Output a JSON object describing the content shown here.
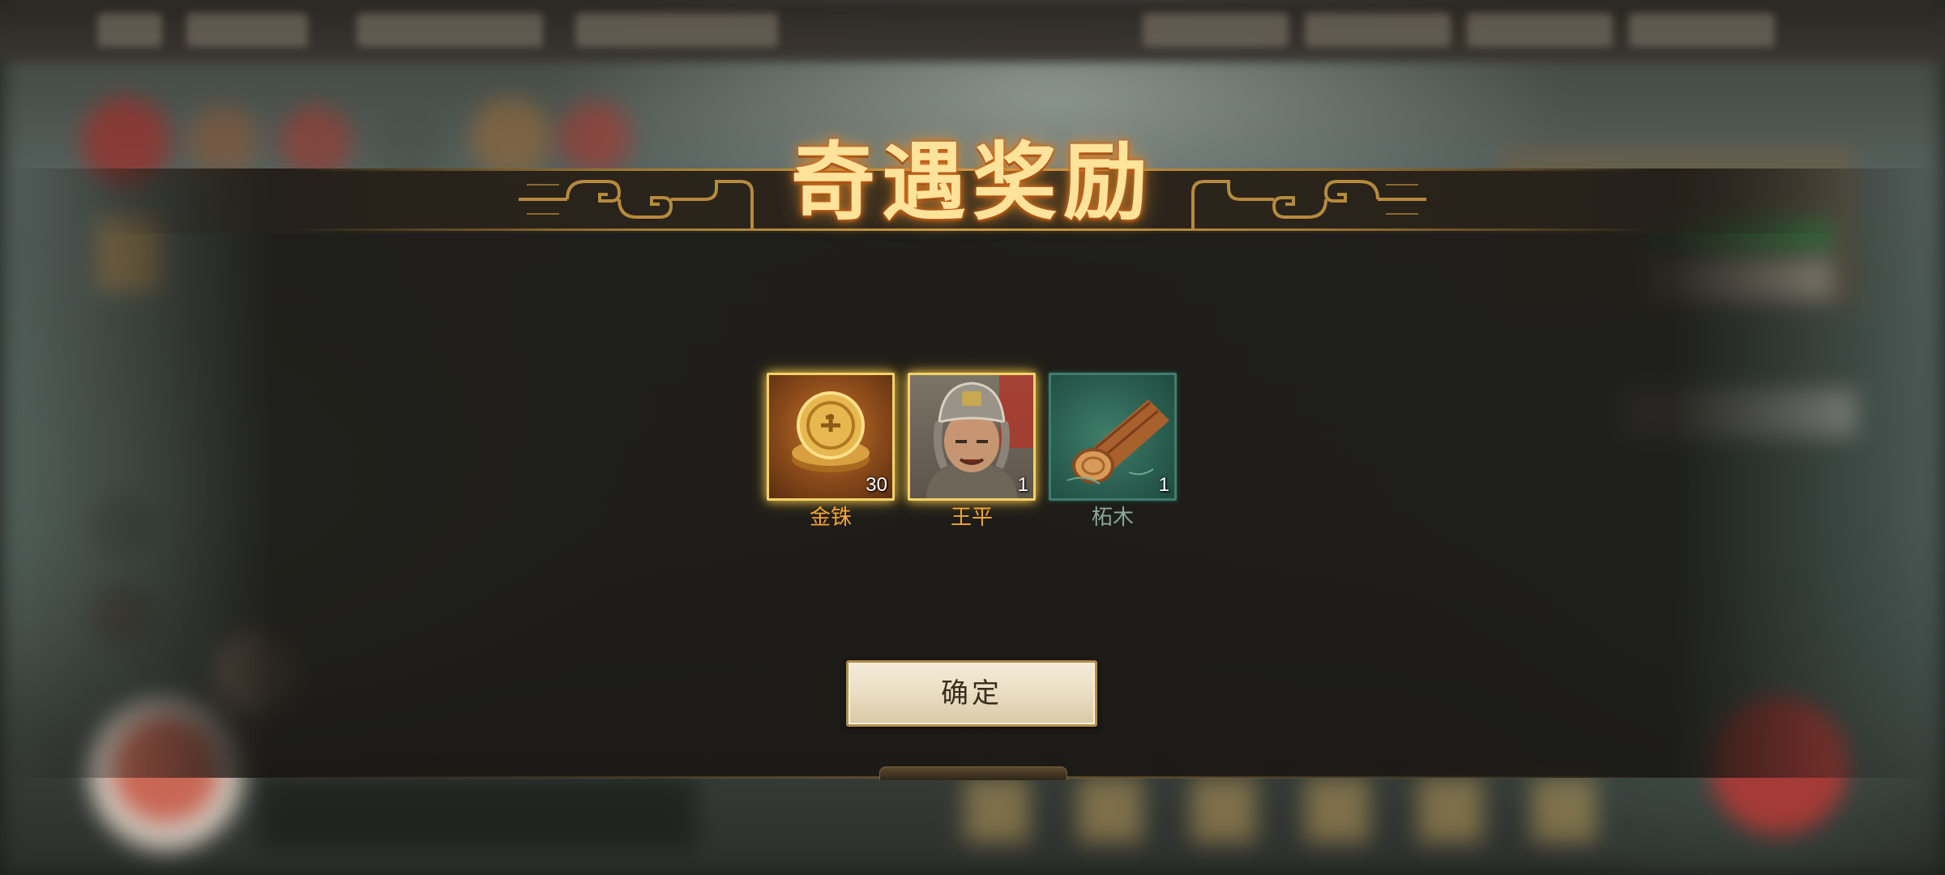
{
  "modal": {
    "title": "奇遇奖励",
    "confirm_label": "确定"
  },
  "rewards": [
    {
      "name": "金铢",
      "count": "30",
      "quality": "gold",
      "icon": "gold-coin-icon"
    },
    {
      "name": "王平",
      "count": "1",
      "quality": "gold",
      "icon": "general-portrait-icon"
    },
    {
      "name": "柘木",
      "count": "1",
      "quality": "green",
      "icon": "wood-log-icon"
    }
  ],
  "colors": {
    "title_text": "#ffe39a",
    "gold_name": "#f0a43a",
    "green_name": "#8aa89c",
    "gold_frame": "#f2d269",
    "green_frame": "#3f7c70",
    "button_bg": "#ebdfc5"
  }
}
